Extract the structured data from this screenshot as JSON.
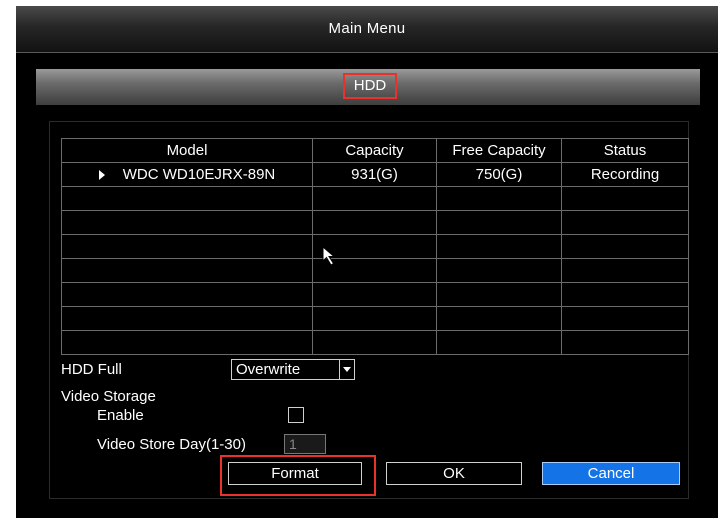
{
  "window": {
    "title": "Main Menu"
  },
  "panel": {
    "title": "HDD"
  },
  "table": {
    "headers": [
      "Model",
      "Capacity",
      "Free Capacity",
      "Status"
    ],
    "rows": [
      {
        "model": "WDC WD10EJRX-89N",
        "capacity": "931(G)",
        "free": "750(G)",
        "status": "Recording"
      }
    ]
  },
  "settings": {
    "hdd_full_label": "HDD Full",
    "hdd_full_value": "Overwrite",
    "video_storage_label": "Video Storage",
    "enable_label": "Enable",
    "enable_checked": false,
    "store_day_label": "Video Store Day(1-30)",
    "store_day_value": "1"
  },
  "buttons": {
    "format": "Format",
    "ok": "OK",
    "cancel": "Cancel"
  },
  "colors": {
    "highlight": "#e8322c",
    "cancel_bg": "#1473e6",
    "background": "#000000",
    "text": "#ffffff"
  }
}
